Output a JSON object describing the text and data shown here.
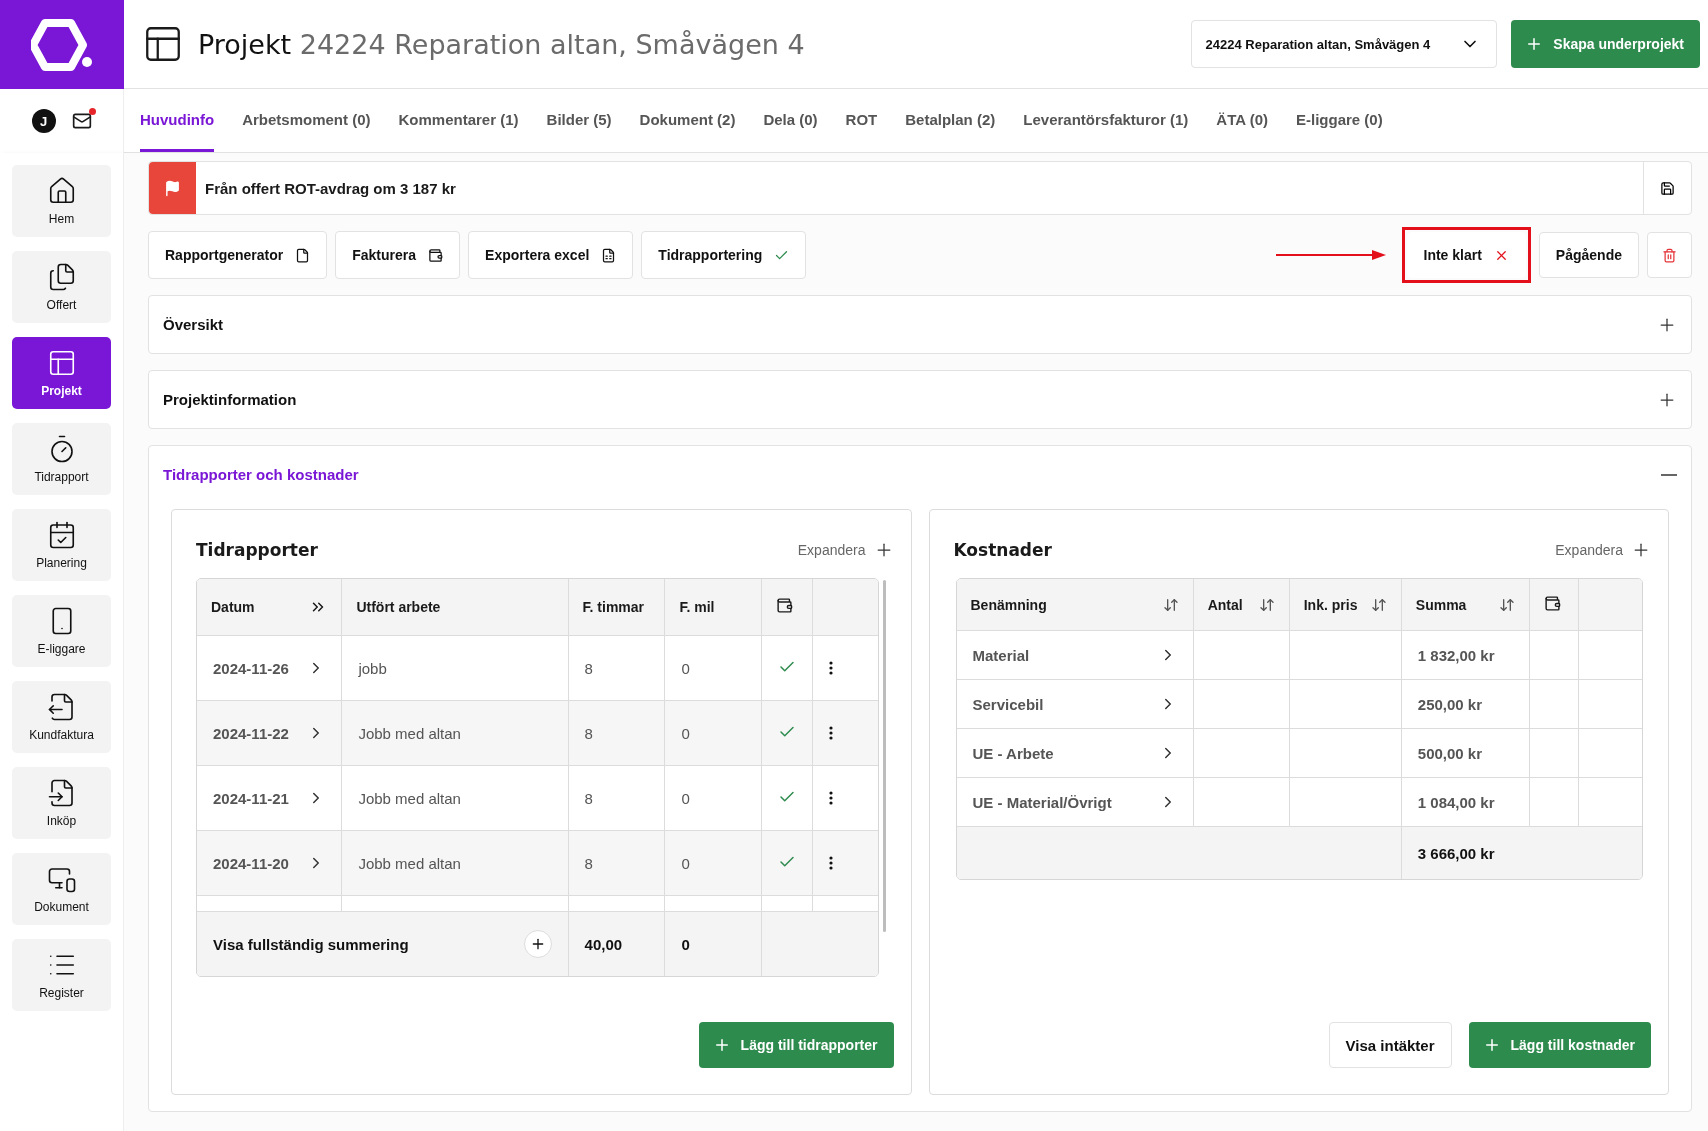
{
  "header": {
    "title_prefix": "Projekt",
    "title": "24224 Reparation altan, Småvägen 4",
    "project_select": "24224 Reparation altan, Småvägen 4",
    "create_button": "Skapa underprojekt"
  },
  "user": {
    "initial": "J",
    "unread_mail": true
  },
  "tabs": [
    {
      "label": "Huvudinfo",
      "selected": true
    },
    {
      "label": "Arbetsmoment (0)",
      "selected": false
    },
    {
      "label": "Kommentarer (1)",
      "selected": false
    },
    {
      "label": "Bilder (5)",
      "selected": false
    },
    {
      "label": "Dokument (2)",
      "selected": false
    },
    {
      "label": "Dela (0)",
      "selected": false
    },
    {
      "label": "ROT",
      "selected": false
    },
    {
      "label": "Betalplan (2)",
      "selected": false
    },
    {
      "label": "Leverantörsfakturor (1)",
      "selected": false
    },
    {
      "label": "ÄTA (0)",
      "selected": false
    },
    {
      "label": "E-liggare (0)",
      "selected": false
    }
  ],
  "sidebar": {
    "items": [
      {
        "label": "Hem",
        "selected": false
      },
      {
        "label": "Offert",
        "selected": false
      },
      {
        "label": "Projekt",
        "selected": true
      },
      {
        "label": "Tidrapport",
        "selected": false
      },
      {
        "label": "Planering",
        "selected": false
      },
      {
        "label": "E-liggare",
        "selected": false
      },
      {
        "label": "Kundfaktura",
        "selected": false
      },
      {
        "label": "Inköp",
        "selected": false
      },
      {
        "label": "Dokument",
        "selected": false
      },
      {
        "label": "Register",
        "selected": false
      }
    ]
  },
  "banner": {
    "text": "Från offert ROT-avdrag om 3 187 kr"
  },
  "actions": [
    {
      "label": "Rapportgenerator"
    },
    {
      "label": "Fakturera"
    },
    {
      "label": "Exportera excel"
    },
    {
      "label": "Tidrapportering"
    }
  ],
  "statuses": [
    {
      "label": "Inte klart",
      "kind": "not-done",
      "highlighted": true
    },
    {
      "label": "Pågående",
      "kind": "plain",
      "highlighted": false
    }
  ],
  "sections": [
    {
      "title": "Översikt",
      "expanded": false
    },
    {
      "title": "Projektinformation",
      "expanded": false
    },
    {
      "title": "Tidrapporter och kostnader",
      "expanded": true
    }
  ],
  "time_reports": {
    "title": "Tidrapporter",
    "expand": "Expandera",
    "columns": [
      "Datum",
      "Utfört arbete",
      "F. timmar",
      "F. mil"
    ],
    "rows": [
      {
        "date": "2024-11-26",
        "work": "jobb",
        "hours": "8",
        "miles": "0",
        "approved": true
      },
      {
        "date": "2024-11-22",
        "work": "Jobb med altan",
        "hours": "8",
        "miles": "0",
        "approved": true
      },
      {
        "date": "2024-11-21",
        "work": "Jobb med altan",
        "hours": "8",
        "miles": "0",
        "approved": true
      },
      {
        "date": "2024-11-20",
        "work": "Jobb med altan",
        "hours": "8",
        "miles": "0",
        "approved": true
      }
    ],
    "footer": {
      "label": "Visa fullständig summering",
      "hours": "40,00",
      "miles": "0"
    },
    "add_button": "Lägg till tidrapporter"
  },
  "costs": {
    "title": "Kostnader",
    "expand": "Expandera",
    "columns": [
      "Benämning",
      "Antal",
      "Ink. pris",
      "Summa"
    ],
    "rows": [
      {
        "name": "Material",
        "sum": "1 832,00 kr"
      },
      {
        "name": "Servicebil",
        "sum": "250,00 kr"
      },
      {
        "name": "UE - Arbete",
        "sum": "500,00 kr"
      },
      {
        "name": "UE - Material/Övrigt",
        "sum": "1 084,00 kr"
      }
    ],
    "total": "3 666,00 kr",
    "secondary_button": "Visa intäkter",
    "add_button": "Lägg till kostnader"
  }
}
